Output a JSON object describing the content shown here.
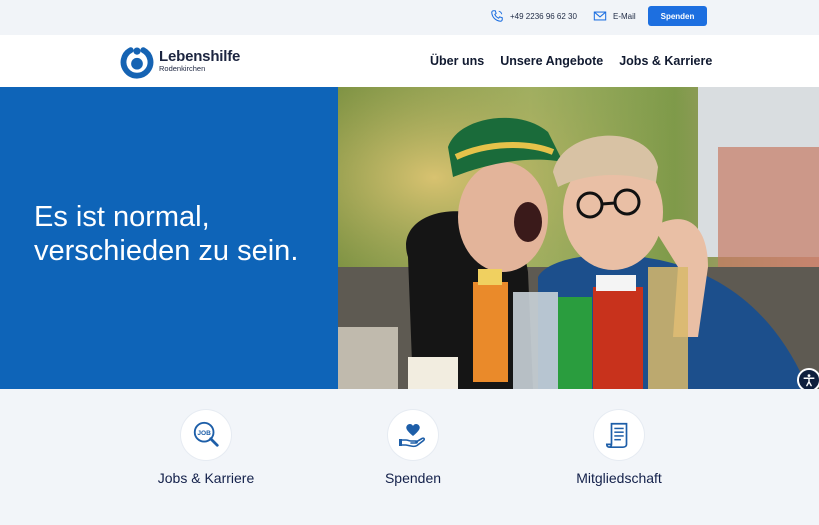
{
  "topbar": {
    "phone": "+49 2236 96 62 30",
    "email_label": "E-Mail",
    "donate_label": "Spenden",
    "phone_icon": "phone-icon",
    "mail_icon": "mail-icon"
  },
  "header": {
    "logo_name": "Lebenshilfe",
    "logo_sub": "Rodenkirchen",
    "nav": [
      {
        "label": "Über uns"
      },
      {
        "label": "Unsere Angebote"
      },
      {
        "label": "Jobs & Karriere"
      }
    ]
  },
  "hero": {
    "title": "Es ist normal, verschieden zu sein."
  },
  "quick_links": [
    {
      "label": "Jobs & Karriere",
      "icon": "job-search-icon"
    },
    {
      "label": "Spenden",
      "icon": "heart-hand-icon"
    },
    {
      "label": "Mitgliedschaft",
      "icon": "document-scroll-icon"
    }
  ],
  "colors": {
    "brand_blue": "#0e64b8",
    "button_blue": "#1d6fe0",
    "navy": "#13204a"
  }
}
